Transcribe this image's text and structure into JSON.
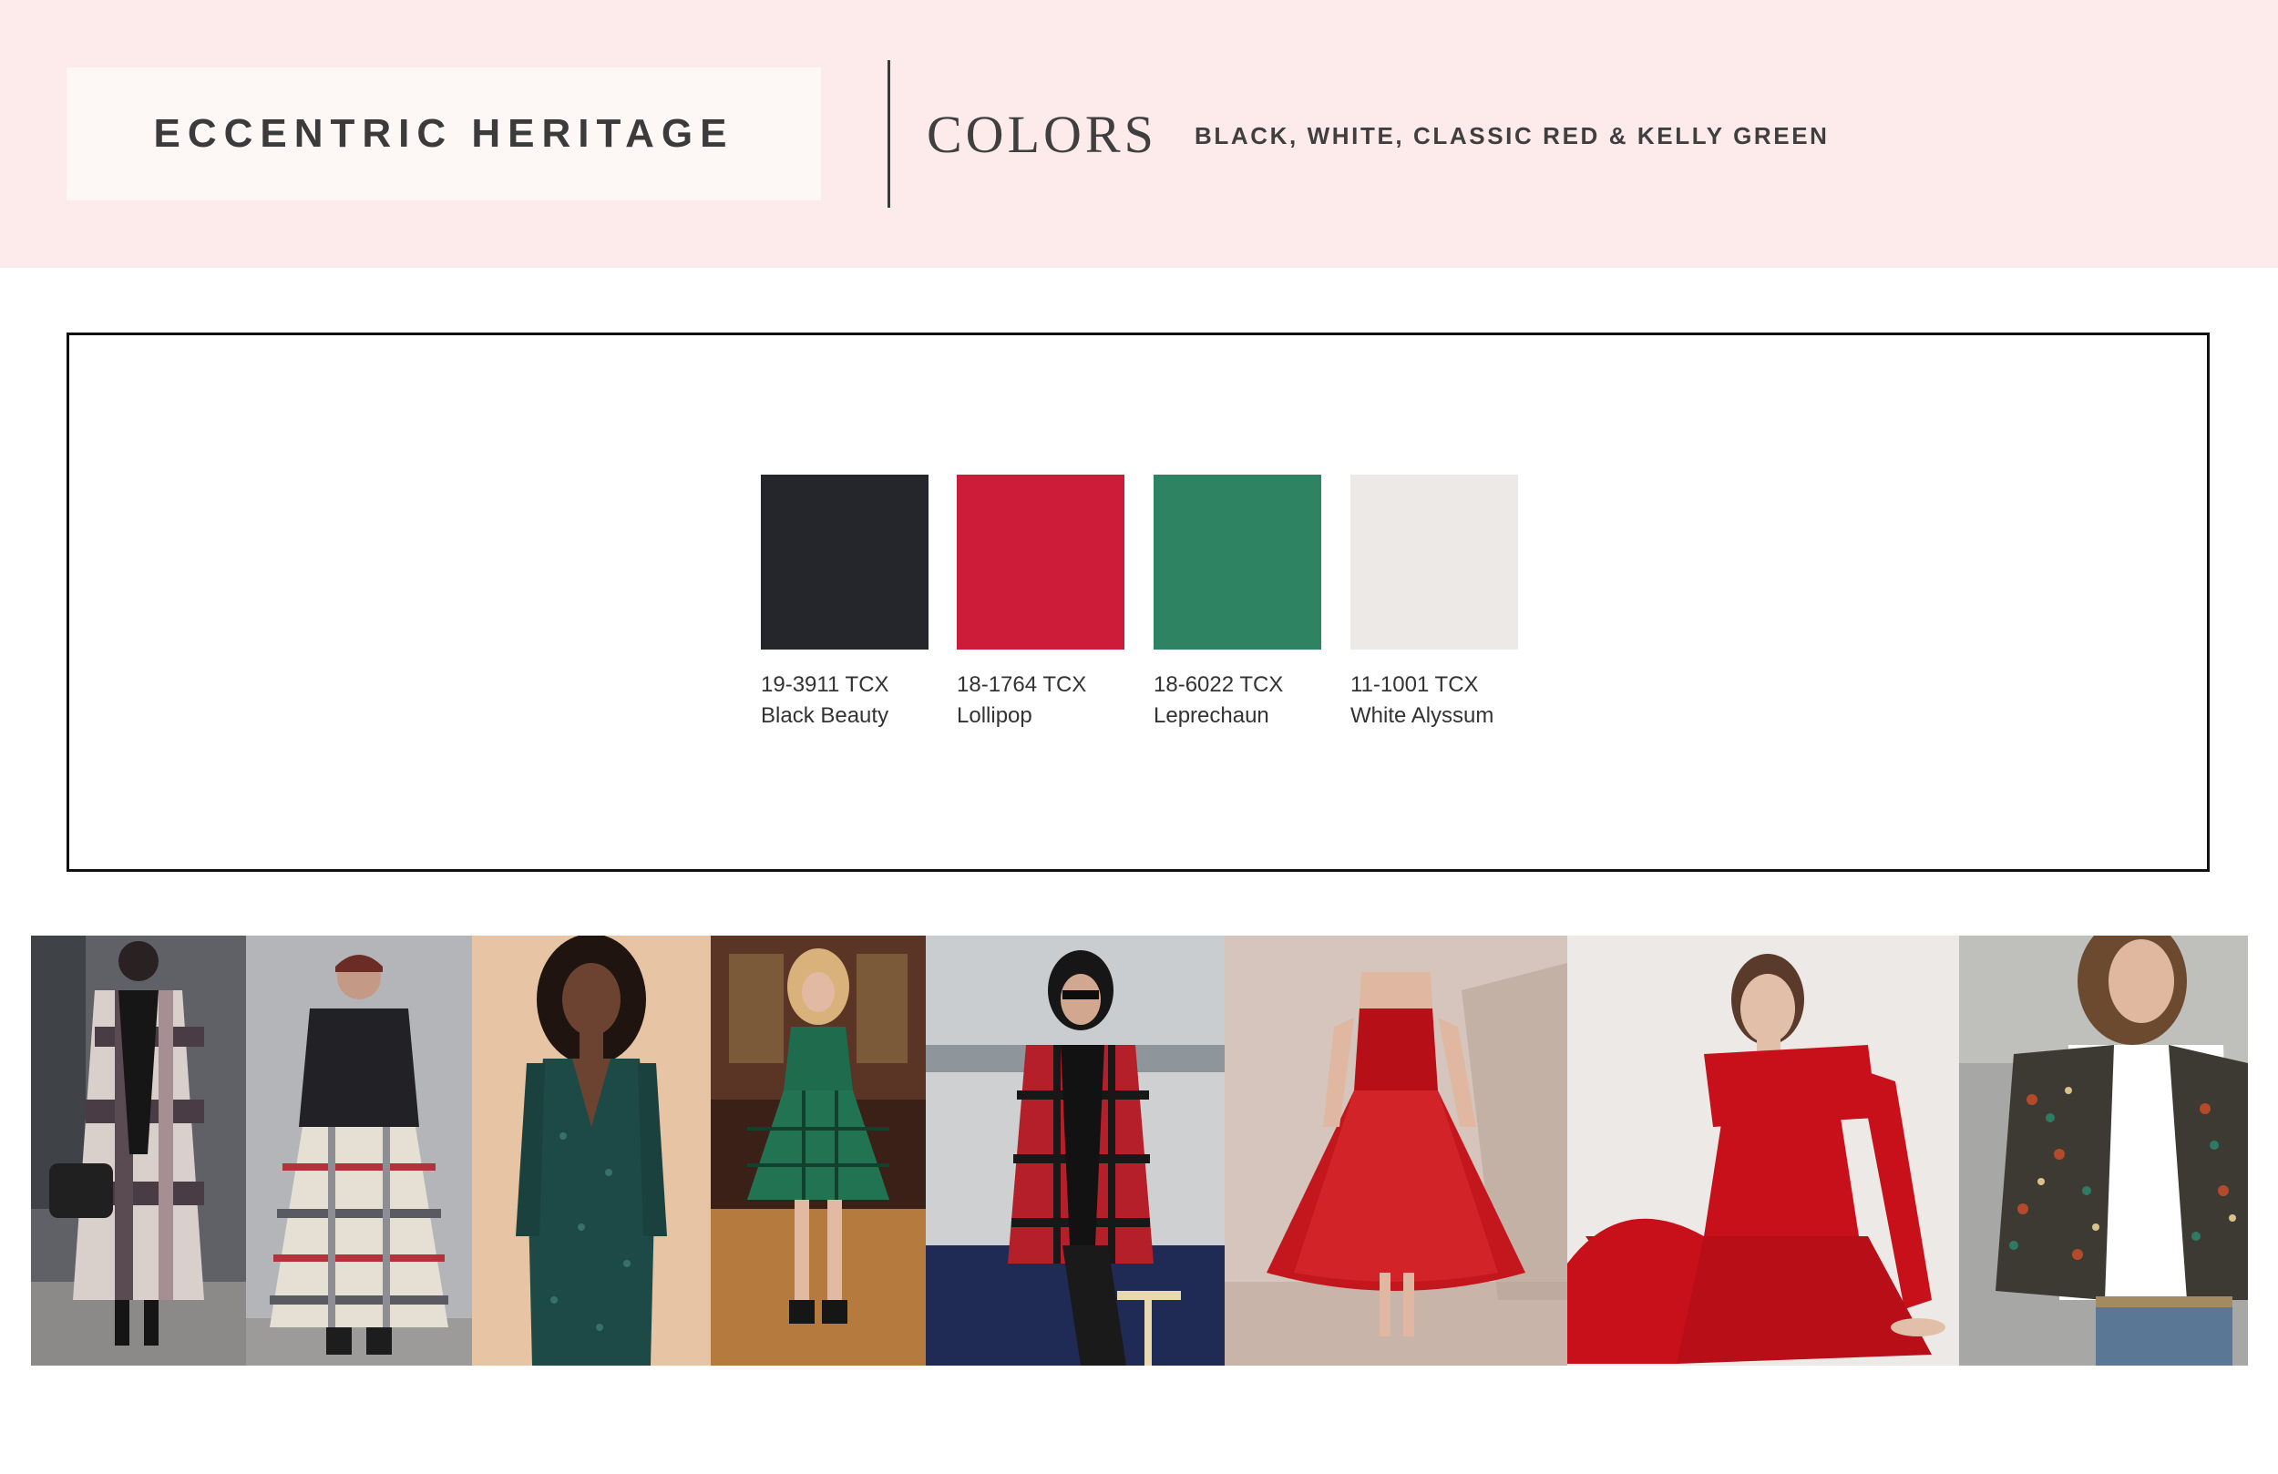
{
  "header": {
    "title": "ECCENTRIC HERITAGE",
    "section_heading": "COLORS",
    "section_subheading": "BLACK, WHITE, CLASSIC RED & KELLY GREEN"
  },
  "palette": [
    {
      "code": "19-3911 TCX",
      "name": "Black Beauty",
      "hex": "#25262b"
    },
    {
      "code": "18-1764 TCX",
      "name": "Lollipop",
      "hex": "#cc1c39"
    },
    {
      "code": "18-6022 TCX",
      "name": "Leprechaun",
      "hex": "#2e8462"
    },
    {
      "code": "11-1001 TCX",
      "name": "White Alyssum",
      "hex": "#ece9e6"
    }
  ],
  "colors": {
    "header_band": "#fdeaea",
    "title_box": "#fdf7f6",
    "text_dark": "#3b3b3b"
  },
  "mood_photos": [
    {
      "subject": "plaid-long-coat"
    },
    {
      "subject": "plaid-maxi-skirt"
    },
    {
      "subject": "green-sequin-dress"
    },
    {
      "subject": "green-plaid-babydoll-dress"
    },
    {
      "subject": "red-plaid-coat"
    },
    {
      "subject": "red-tulle-dress"
    },
    {
      "subject": "red-off-shoulder-dress"
    },
    {
      "subject": "sequin-jacket"
    }
  ]
}
